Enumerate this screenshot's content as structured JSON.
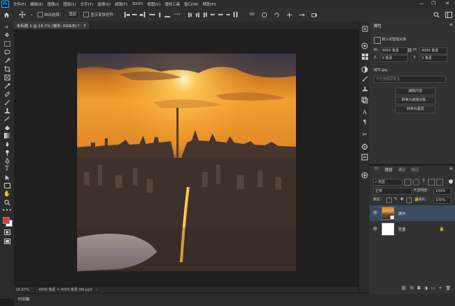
{
  "app": {
    "logo": "Ps"
  },
  "menu": [
    "文件(F)",
    "编辑(E)",
    "图像(I)",
    "图层(L)",
    "文字(Y)",
    "选择(S)",
    "滤镜(T)",
    "3D(D)",
    "视图(V)",
    "增效工具",
    "窗口(W)",
    "帮助(H)"
  ],
  "window_controls": {
    "minimize": "—",
    "restore": "❐",
    "close": "✕"
  },
  "options": {
    "auto_select_label": "自动选择：",
    "auto_select_target": "图层",
    "show_transform_label": "显示变换控件",
    "more": "•••"
  },
  "document": {
    "tab_title": "未标题-1 @ 16.7% (城市, RGB/8) *",
    "tab_close": "×"
  },
  "status": {
    "zoom": "16.67%",
    "dimensions": "4000 像素 × 4000 像素 (96 ppi)"
  },
  "timeline": {
    "label": "时间轴"
  },
  "properties": {
    "tab": "属性",
    "section_title": "嵌入的智能对象",
    "w_label": "W:",
    "w_value": "4000 像素",
    "h_label": "H:",
    "h_value": "4000 像素",
    "x_label": "X:",
    "x_value": "0 像素",
    "y_label": "Y:",
    "y_value": "0 像素",
    "filename": "城市.jpg",
    "comp_placeholder": "不应用图层复合",
    "btn_edit": "编辑内容",
    "btn_convert_linked": "转换为链接对象...",
    "btn_convert_layers": "转换为图层"
  },
  "layers_panel": {
    "tabs": [
      "3D",
      "图层",
      "通道",
      "路径"
    ],
    "active_tab": "图层",
    "filter_label": "类型",
    "blend_mode": "正常",
    "opacity_label": "不透明度：",
    "opacity_value": "100%",
    "lock_label": "锁定：",
    "fill_label": "填充：",
    "fill_value": "100%",
    "layers": [
      {
        "name": "城市",
        "selected": true
      },
      {
        "name": "背景",
        "selected": false
      }
    ]
  },
  "colors": {
    "accent": "#31a8ff",
    "foreground": "#e53935",
    "background": "#ffffff",
    "selection": "#3b4a5c"
  }
}
